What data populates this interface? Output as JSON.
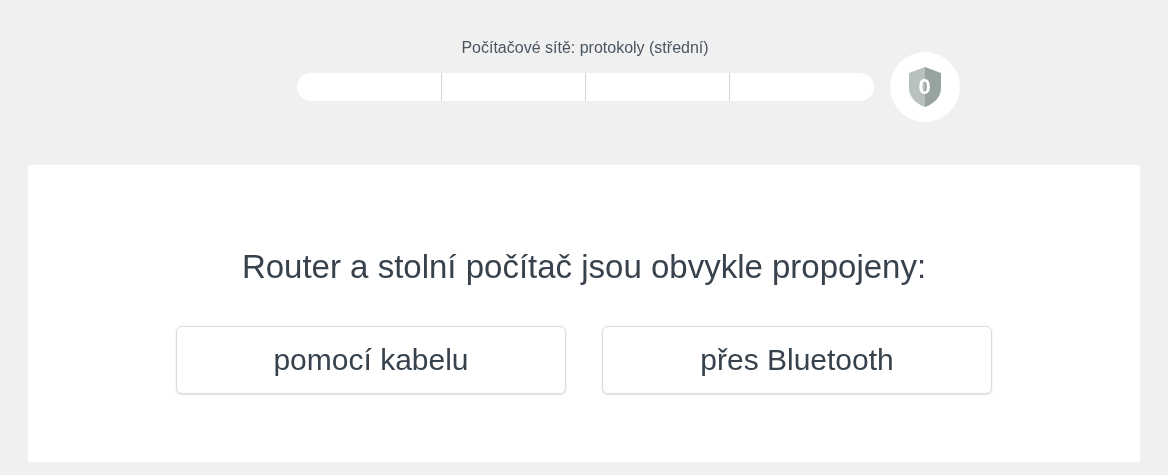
{
  "progress": {
    "title": "Počítačové sítě: protokoly (střední)",
    "badge": "0"
  },
  "question": {
    "text": "Router a stolní počítač jsou obvykle propojeny:"
  },
  "answers": [
    {
      "label": "pomocí kabelu"
    },
    {
      "label": "přes Bluetooth"
    }
  ]
}
